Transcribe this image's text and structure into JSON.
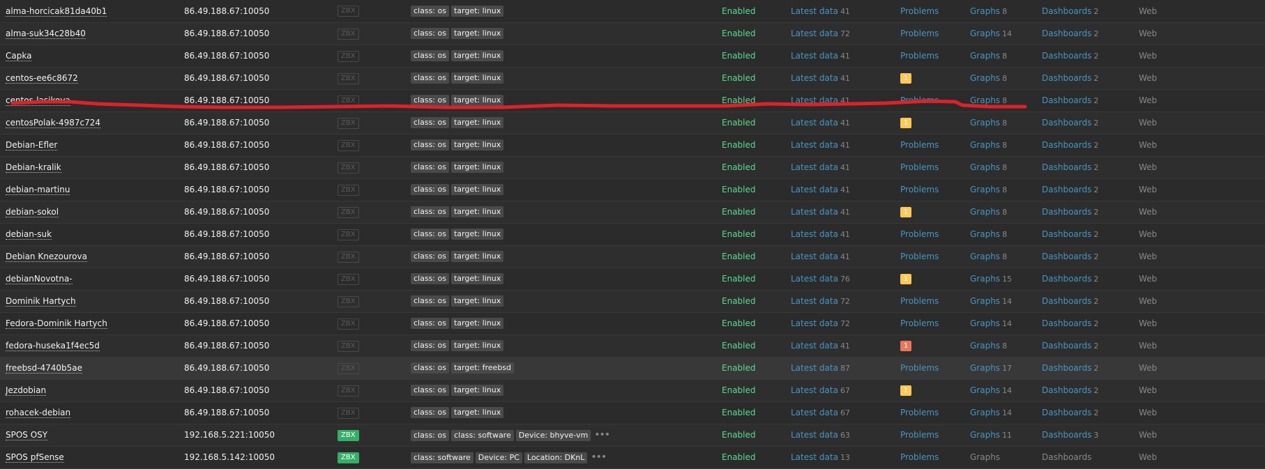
{
  "colors": {
    "warning": "#ffc859",
    "average": "#e97659",
    "enabled": "#59db8f",
    "link": "#4796c4",
    "annotation": "#e0202a"
  },
  "rows": [
    {
      "name": "alma-horcicak81da40b1",
      "iface": "86.49.188.67:10050",
      "zbx": "ZBX",
      "zbx_on": false,
      "tags": [
        "class: os",
        "target: linux"
      ],
      "more": false,
      "status": "Enabled",
      "latest": "Latest data",
      "latest_n": "41",
      "problems": "Problems",
      "problem_count": "",
      "severity": "",
      "graphs": "Graphs",
      "graphs_n": "8",
      "graphs_active": true,
      "dashboards": "Dashboards",
      "dashboards_n": "2",
      "dashboards_active": true,
      "web": "Web",
      "highlight": false
    },
    {
      "name": "alma-suk34c28b40",
      "iface": "86.49.188.67:10050",
      "zbx": "ZBX",
      "zbx_on": false,
      "tags": [
        "class: os",
        "target: linux"
      ],
      "more": false,
      "status": "Enabled",
      "latest": "Latest data",
      "latest_n": "72",
      "problems": "Problems",
      "problem_count": "",
      "severity": "",
      "graphs": "Graphs",
      "graphs_n": "14",
      "graphs_active": true,
      "dashboards": "Dashboards",
      "dashboards_n": "2",
      "dashboards_active": true,
      "web": "Web",
      "highlight": false
    },
    {
      "name": "Capka",
      "iface": "86.49.188.67:10050",
      "zbx": "ZBX",
      "zbx_on": false,
      "tags": [
        "class: os",
        "target: linux"
      ],
      "more": false,
      "status": "Enabled",
      "latest": "Latest data",
      "latest_n": "41",
      "problems": "Problems",
      "problem_count": "",
      "severity": "",
      "graphs": "Graphs",
      "graphs_n": "8",
      "graphs_active": true,
      "dashboards": "Dashboards",
      "dashboards_n": "2",
      "dashboards_active": true,
      "web": "Web",
      "highlight": false
    },
    {
      "name": "centos-ee6c8672",
      "iface": "86.49.188.67:10050",
      "zbx": "ZBX",
      "zbx_on": false,
      "tags": [
        "class: os",
        "target: linux"
      ],
      "more": false,
      "status": "Enabled",
      "latest": "Latest data",
      "latest_n": "41",
      "problems": "",
      "problem_count": "1",
      "severity": "warning",
      "graphs": "Graphs",
      "graphs_n": "8",
      "graphs_active": true,
      "dashboards": "Dashboards",
      "dashboards_n": "2",
      "dashboards_active": true,
      "web": "Web",
      "highlight": false
    },
    {
      "name": "centos-lasikova",
      "iface": "86.49.188.67:10050",
      "zbx": "ZBX",
      "zbx_on": false,
      "tags": [
        "class: os",
        "target: linux"
      ],
      "more": false,
      "status": "Enabled",
      "latest": "Latest data",
      "latest_n": "41",
      "problems": "Problems",
      "problem_count": "",
      "severity": "",
      "graphs": "Graphs",
      "graphs_n": "8",
      "graphs_active": true,
      "dashboards": "Dashboards",
      "dashboards_n": "2",
      "dashboards_active": true,
      "web": "Web",
      "highlight": false
    },
    {
      "name": "centosPolak-4987c724",
      "iface": "86.49.188.67:10050",
      "zbx": "ZBX",
      "zbx_on": false,
      "tags": [
        "class: os",
        "target: linux"
      ],
      "more": false,
      "status": "Enabled",
      "latest": "Latest data",
      "latest_n": "41",
      "problems": "",
      "problem_count": "1",
      "severity": "warning",
      "graphs": "Graphs",
      "graphs_n": "8",
      "graphs_active": true,
      "dashboards": "Dashboards",
      "dashboards_n": "2",
      "dashboards_active": true,
      "web": "Web",
      "highlight": false
    },
    {
      "name": "Debian-Efler",
      "iface": "86.49.188.67:10050",
      "zbx": "ZBX",
      "zbx_on": false,
      "tags": [
        "class: os",
        "target: linux"
      ],
      "more": false,
      "status": "Enabled",
      "latest": "Latest data",
      "latest_n": "41",
      "problems": "Problems",
      "problem_count": "",
      "severity": "",
      "graphs": "Graphs",
      "graphs_n": "8",
      "graphs_active": true,
      "dashboards": "Dashboards",
      "dashboards_n": "2",
      "dashboards_active": true,
      "web": "Web",
      "highlight": false
    },
    {
      "name": "Debian-kralik",
      "iface": "86.49.188.67:10050",
      "zbx": "ZBX",
      "zbx_on": false,
      "tags": [
        "class: os",
        "target: linux"
      ],
      "more": false,
      "status": "Enabled",
      "latest": "Latest data",
      "latest_n": "41",
      "problems": "Problems",
      "problem_count": "",
      "severity": "",
      "graphs": "Graphs",
      "graphs_n": "8",
      "graphs_active": true,
      "dashboards": "Dashboards",
      "dashboards_n": "2",
      "dashboards_active": true,
      "web": "Web",
      "highlight": false
    },
    {
      "name": "debian-martinu",
      "iface": "86.49.188.67:10050",
      "zbx": "ZBX",
      "zbx_on": false,
      "tags": [
        "class: os",
        "target: linux"
      ],
      "more": false,
      "status": "Enabled",
      "latest": "Latest data",
      "latest_n": "41",
      "problems": "Problems",
      "problem_count": "",
      "severity": "",
      "graphs": "Graphs",
      "graphs_n": "8",
      "graphs_active": true,
      "dashboards": "Dashboards",
      "dashboards_n": "2",
      "dashboards_active": true,
      "web": "Web",
      "highlight": false
    },
    {
      "name": "debian-sokol",
      "iface": "86.49.188.67:10050",
      "zbx": "ZBX",
      "zbx_on": false,
      "tags": [
        "class: os",
        "target: linux"
      ],
      "more": false,
      "status": "Enabled",
      "latest": "Latest data",
      "latest_n": "41",
      "problems": "",
      "problem_count": "1",
      "severity": "warning",
      "graphs": "Graphs",
      "graphs_n": "8",
      "graphs_active": true,
      "dashboards": "Dashboards",
      "dashboards_n": "2",
      "dashboards_active": true,
      "web": "Web",
      "highlight": false
    },
    {
      "name": "debian-suk",
      "iface": "86.49.188.67:10050",
      "zbx": "ZBX",
      "zbx_on": false,
      "tags": [
        "class: os",
        "target: linux"
      ],
      "more": false,
      "status": "Enabled",
      "latest": "Latest data",
      "latest_n": "41",
      "problems": "Problems",
      "problem_count": "",
      "severity": "",
      "graphs": "Graphs",
      "graphs_n": "8",
      "graphs_active": true,
      "dashboards": "Dashboards",
      "dashboards_n": "2",
      "dashboards_active": true,
      "web": "Web",
      "highlight": false
    },
    {
      "name": "Debian Knezourova",
      "iface": "86.49.188.67:10050",
      "zbx": "ZBX",
      "zbx_on": false,
      "tags": [
        "class: os",
        "target: linux"
      ],
      "more": false,
      "status": "Enabled",
      "latest": "Latest data",
      "latest_n": "41",
      "problems": "Problems",
      "problem_count": "",
      "severity": "",
      "graphs": "Graphs",
      "graphs_n": "8",
      "graphs_active": true,
      "dashboards": "Dashboards",
      "dashboards_n": "2",
      "dashboards_active": true,
      "web": "Web",
      "highlight": false
    },
    {
      "name": "debianNovotna-",
      "iface": "86.49.188.67:10050",
      "zbx": "ZBX",
      "zbx_on": false,
      "tags": [
        "class: os",
        "target: linux"
      ],
      "more": false,
      "status": "Enabled",
      "latest": "Latest data",
      "latest_n": "76",
      "problems": "",
      "problem_count": "1",
      "severity": "warning",
      "graphs": "Graphs",
      "graphs_n": "15",
      "graphs_active": true,
      "dashboards": "Dashboards",
      "dashboards_n": "2",
      "dashboards_active": true,
      "web": "Web",
      "highlight": false
    },
    {
      "name": "Dominik Hartych",
      "iface": "86.49.188.67:10050",
      "zbx": "ZBX",
      "zbx_on": false,
      "tags": [
        "class: os",
        "target: linux"
      ],
      "more": false,
      "status": "Enabled",
      "latest": "Latest data",
      "latest_n": "72",
      "problems": "Problems",
      "problem_count": "",
      "severity": "",
      "graphs": "Graphs",
      "graphs_n": "14",
      "graphs_active": true,
      "dashboards": "Dashboards",
      "dashboards_n": "2",
      "dashboards_active": true,
      "web": "Web",
      "highlight": false
    },
    {
      "name": "Fedora-Dominik Hartych",
      "iface": "86.49.188.67:10050",
      "zbx": "ZBX",
      "zbx_on": false,
      "tags": [
        "class: os",
        "target: linux"
      ],
      "more": false,
      "status": "Enabled",
      "latest": "Latest data",
      "latest_n": "72",
      "problems": "Problems",
      "problem_count": "",
      "severity": "",
      "graphs": "Graphs",
      "graphs_n": "14",
      "graphs_active": true,
      "dashboards": "Dashboards",
      "dashboards_n": "2",
      "dashboards_active": true,
      "web": "Web",
      "highlight": false
    },
    {
      "name": "fedora-huseka1f4ec5d",
      "iface": "86.49.188.67:10050",
      "zbx": "ZBX",
      "zbx_on": false,
      "tags": [
        "class: os",
        "target: linux"
      ],
      "more": false,
      "status": "Enabled",
      "latest": "Latest data",
      "latest_n": "41",
      "problems": "",
      "problem_count": "1",
      "severity": "average",
      "graphs": "Graphs",
      "graphs_n": "8",
      "graphs_active": true,
      "dashboards": "Dashboards",
      "dashboards_n": "2",
      "dashboards_active": true,
      "web": "Web",
      "highlight": false
    },
    {
      "name": "freebsd-4740b5ae",
      "iface": "86.49.188.67:10050",
      "zbx": "ZBX",
      "zbx_on": false,
      "tags": [
        "class: os",
        "target: freebsd"
      ],
      "more": false,
      "status": "Enabled",
      "latest": "Latest data",
      "latest_n": "87",
      "problems": "Problems",
      "problem_count": "",
      "severity": "",
      "graphs": "Graphs",
      "graphs_n": "17",
      "graphs_active": true,
      "dashboards": "Dashboards",
      "dashboards_n": "2",
      "dashboards_active": true,
      "web": "Web",
      "highlight": true
    },
    {
      "name": "Jezdobian",
      "iface": "86.49.188.67:10050",
      "zbx": "ZBX",
      "zbx_on": false,
      "tags": [
        "class: os",
        "target: linux"
      ],
      "more": false,
      "status": "Enabled",
      "latest": "Latest data",
      "latest_n": "67",
      "problems": "",
      "problem_count": "1",
      "severity": "warning",
      "graphs": "Graphs",
      "graphs_n": "14",
      "graphs_active": true,
      "dashboards": "Dashboards",
      "dashboards_n": "2",
      "dashboards_active": true,
      "web": "Web",
      "highlight": false
    },
    {
      "name": "rohacek-debian",
      "iface": "86.49.188.67:10050",
      "zbx": "ZBX",
      "zbx_on": false,
      "tags": [
        "class: os",
        "target: linux"
      ],
      "more": false,
      "status": "Enabled",
      "latest": "Latest data",
      "latest_n": "67",
      "problems": "Problems",
      "problem_count": "",
      "severity": "",
      "graphs": "Graphs",
      "graphs_n": "14",
      "graphs_active": true,
      "dashboards": "Dashboards",
      "dashboards_n": "2",
      "dashboards_active": true,
      "web": "Web",
      "highlight": false
    },
    {
      "name": "SPOS OSY",
      "iface": "192.168.5.221:10050",
      "zbx": "ZBX",
      "zbx_on": true,
      "tags": [
        "class: os",
        "class: software",
        "Device: bhyve-vm"
      ],
      "more": true,
      "status": "Enabled",
      "latest": "Latest data",
      "latest_n": "63",
      "problems": "Problems",
      "problem_count": "",
      "severity": "",
      "graphs": "Graphs",
      "graphs_n": "11",
      "graphs_active": true,
      "dashboards": "Dashboards",
      "dashboards_n": "3",
      "dashboards_active": true,
      "web": "Web",
      "highlight": false
    },
    {
      "name": "SPOS pfSense",
      "iface": "192.168.5.142:10050",
      "zbx": "ZBX",
      "zbx_on": true,
      "tags": [
        "class: software",
        "Device: PC",
        "Location: DKnL"
      ],
      "more": true,
      "status": "Enabled",
      "latest": "Latest data",
      "latest_n": "13",
      "problems": "Problems",
      "problem_count": "",
      "severity": "",
      "graphs": "Graphs",
      "graphs_n": "",
      "graphs_active": false,
      "dashboards": "Dashboards",
      "dashboards_n": "",
      "dashboards_active": false,
      "web": "Web",
      "highlight": false
    }
  ]
}
